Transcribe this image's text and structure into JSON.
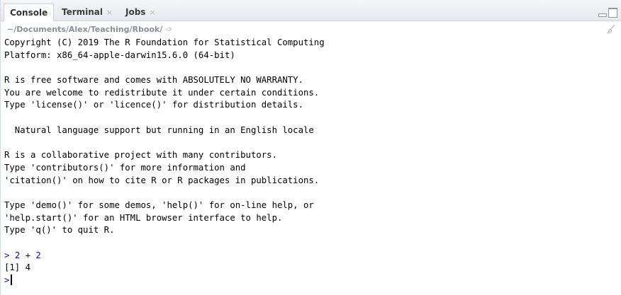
{
  "tabs": [
    {
      "label": "Console",
      "active": true,
      "closable": false
    },
    {
      "label": "Terminal",
      "active": false,
      "closable": true
    },
    {
      "label": "Jobs",
      "active": false,
      "closable": true
    }
  ],
  "tab_close_glyph": "×",
  "path": "~/Documents/Alex/Teaching/Rbook/",
  "path_icon": "goto-directory-icon",
  "console": {
    "startup_lines": [
      "Copyright (C) 2019 The R Foundation for Statistical Computing",
      "Platform: x86_64-apple-darwin15.6.0 (64-bit)",
      "",
      "R is free software and comes with ABSOLUTELY NO WARRANTY.",
      "You are welcome to redistribute it under certain conditions.",
      "Type 'license()' or 'licence()' for distribution details.",
      "",
      "  Natural language support but running in an English locale",
      "",
      "R is a collaborative project with many contributors.",
      "Type 'contributors()' for more information and",
      "'citation()' on how to cite R or R packages in publications.",
      "",
      "Type 'demo()' for some demos, 'help()' for on-line help, or",
      "'help.start()' for an HTML browser interface to help.",
      "Type 'q()' to quit R.",
      ""
    ],
    "prompt_symbol": ">",
    "command": "2 + 2",
    "output": "[1] 4"
  },
  "colors": {
    "prompt": "#0000ff",
    "output": "#000000",
    "path": "#8a8f96"
  }
}
